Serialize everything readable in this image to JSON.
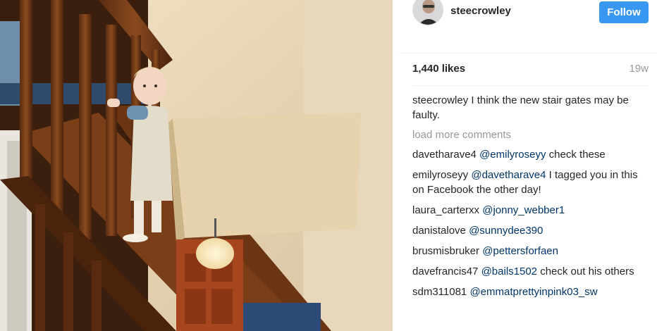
{
  "post": {
    "username": "steecrowley",
    "follow_label": "Follow",
    "likes": "1,440 likes",
    "age": "19w"
  },
  "caption": {
    "user": "steecrowley",
    "text": "I think the new stair gates may be faulty."
  },
  "load_more": "load more comments",
  "comments": [
    {
      "user": "davetharave4",
      "mention": "@emilyroseyy",
      "text": "check these"
    },
    {
      "user": "emilyroseyy",
      "mention": "@davetharave4",
      "text": "I tagged you in this on Facebook the other day!"
    },
    {
      "user": "laura_carterxx",
      "mention": "@jonny_webber1",
      "text": ""
    },
    {
      "user": "danistalove",
      "mention": "@sunnydee390",
      "text": ""
    },
    {
      "user": "brusmisbruker",
      "mention": "@pettersforfaen",
      "text": ""
    },
    {
      "user": "davefrancis47",
      "mention": "@bails1502",
      "text": "check out his others"
    },
    {
      "user": "sdm311081",
      "mention": "@emmatprettyinpink03_sw",
      "text": ""
    }
  ],
  "colors": {
    "follow_button": "#3897f0",
    "mention": "#003569",
    "muted": "#999999"
  }
}
